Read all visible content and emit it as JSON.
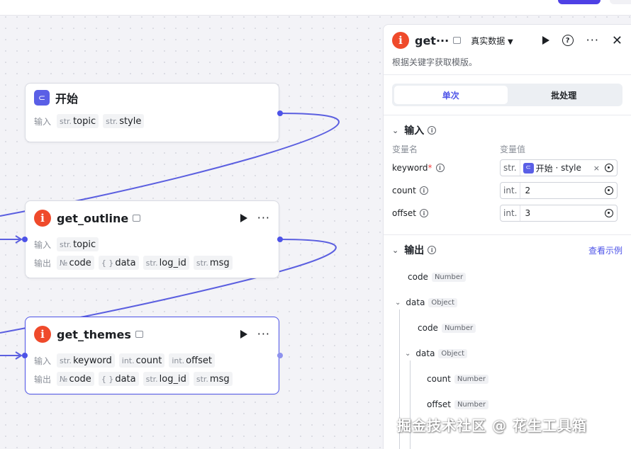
{
  "nodes": {
    "start": {
      "title": "开始",
      "input_label": "输入",
      "inputs": [
        {
          "type": "str.",
          "name": "topic"
        },
        {
          "type": "str.",
          "name": "style"
        }
      ]
    },
    "get_outline": {
      "title": "get_outline",
      "input_label": "输入",
      "output_label": "输出",
      "inputs": [
        {
          "type": "str.",
          "name": "topic"
        }
      ],
      "outputs": [
        {
          "type": "№",
          "name": "code"
        },
        {
          "type": "{ }",
          "name": "data"
        },
        {
          "type": "str.",
          "name": "log_id"
        },
        {
          "type": "str.",
          "name": "msg"
        }
      ]
    },
    "get_themes": {
      "title": "get_themes",
      "input_label": "输入",
      "output_label": "输出",
      "inputs": [
        {
          "type": "str.",
          "name": "keyword"
        },
        {
          "type": "int.",
          "name": "count"
        },
        {
          "type": "int.",
          "name": "offset"
        }
      ],
      "outputs": [
        {
          "type": "№",
          "name": "code"
        },
        {
          "type": "{ }",
          "name": "data"
        },
        {
          "type": "str.",
          "name": "log_id"
        },
        {
          "type": "str.",
          "name": "msg"
        }
      ]
    }
  },
  "panel": {
    "title": "get···",
    "data_mode": "真实数据",
    "description": "根据关键字获取模版。",
    "tabs": [
      "单次",
      "批处理"
    ],
    "input_section": "输入",
    "col_name": "变量名",
    "col_value": "变量值",
    "params": [
      {
        "name": "keyword",
        "required": "*",
        "type": "str.",
        "ref_node": "开始",
        "ref_sep": "·",
        "ref_var": "style"
      },
      {
        "name": "count",
        "type": "int.",
        "value": "2"
      },
      {
        "name": "offset",
        "type": "int.",
        "value": "3"
      }
    ],
    "output_section": "输出",
    "example_link": "查看示例",
    "outputs": [
      {
        "name": "code",
        "type": "Number"
      },
      {
        "name": "data",
        "type": "Object"
      },
      {
        "name": "code",
        "type": "Number"
      },
      {
        "name": "data",
        "type": "Object"
      },
      {
        "name": "count",
        "type": "Number"
      },
      {
        "name": "offset",
        "type": "Number"
      }
    ]
  },
  "watermark": "掘金技术社区 @ 花生工具箱",
  "colors": {
    "accent": "#4d53e8",
    "edge": "#5b5fe0",
    "plugin_badge": "#ef4a2b",
    "arrow": "#e8261f"
  },
  "icons": [
    "start-icon",
    "plugin-icon",
    "play-icon",
    "more-icon",
    "help-icon",
    "close-icon",
    "info-icon",
    "target-icon",
    "chevron-down-icon",
    "dropdown-caret-icon"
  ]
}
